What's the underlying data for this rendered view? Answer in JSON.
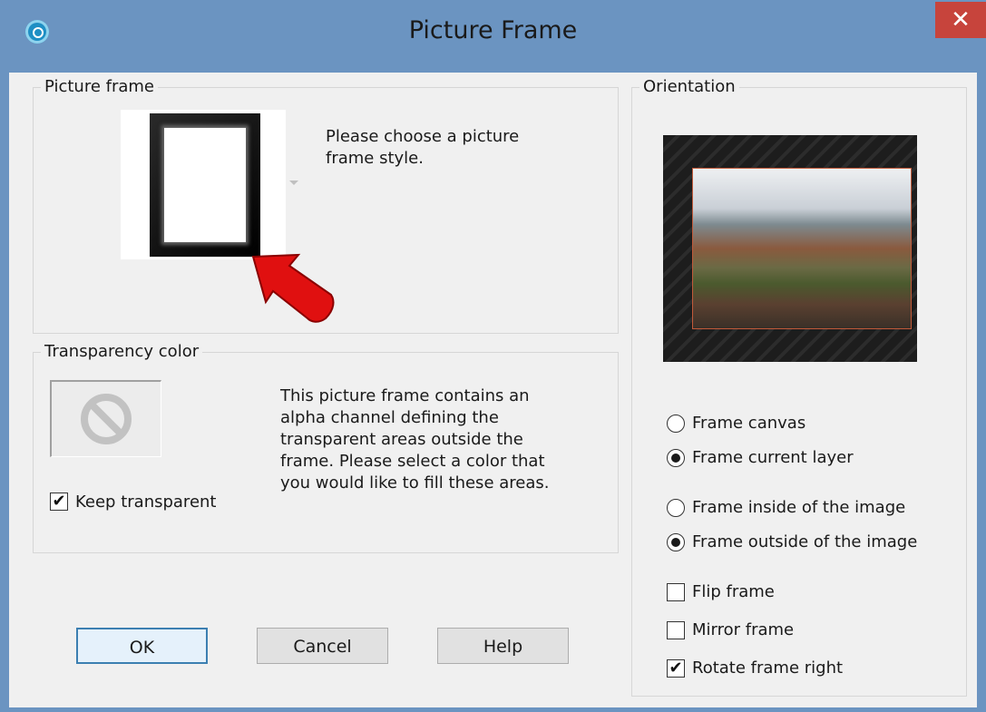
{
  "window": {
    "title": "Picture Frame",
    "close_icon": "close-icon",
    "app_icon": "app-icon"
  },
  "picture_frame": {
    "legend": "Picture frame",
    "hint_line1": "Please choose a picture",
    "hint_line2": "frame style."
  },
  "transparency": {
    "legend": "Transparency color",
    "desc_line1": "This picture frame contains an",
    "desc_line2": "alpha channel defining the",
    "desc_line3": "transparent areas outside the",
    "desc_line4": "frame.  Please select a color that",
    "desc_line5": "you would like to fill these areas.",
    "keep_transparent_label": "Keep transparent",
    "keep_transparent_checked": true
  },
  "orientation": {
    "legend": "Orientation",
    "frame_canvas": "Frame canvas",
    "frame_current_layer": "Frame current layer",
    "frame_inside": "Frame inside of the image",
    "frame_outside": "Frame outside of the image",
    "flip_frame": "Flip frame",
    "mirror_frame": "Mirror frame",
    "rotate_frame_right": "Rotate frame right",
    "selected_target": "Frame current layer",
    "selected_position": "Frame outside of the image",
    "flip_checked": false,
    "mirror_checked": false,
    "rotate_checked": true
  },
  "buttons": {
    "ok": "OK",
    "cancel": "Cancel",
    "help": "Help"
  },
  "colors": {
    "title_bar": "#6b94c1",
    "close": "#c7443c",
    "arrow": "#e01010",
    "dialog_bg": "#f0f0f0"
  }
}
